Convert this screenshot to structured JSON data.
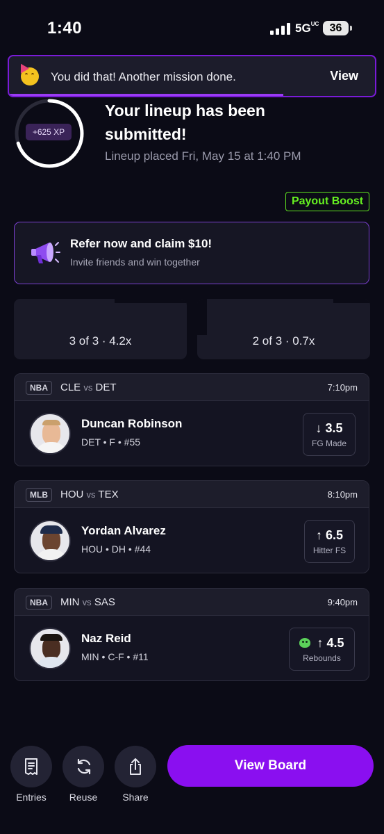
{
  "status_bar": {
    "time": "1:40",
    "network": "5G",
    "network_sup": "UC",
    "battery": "36"
  },
  "toast": {
    "message": "You did that! Another mission done.",
    "action": "View",
    "emoji": "partying-face-icon",
    "progress": 0.75
  },
  "submission": {
    "xp_label": "+625 XP",
    "xp_ring_progress": 0.7,
    "title": "Your lineup has been submitted!",
    "subtitle": "Lineup placed Fri, May 15 at 1:40 PM"
  },
  "payout_boost": "Payout Boost",
  "refer": {
    "icon": "megaphone-icon",
    "title": "Refer now and claim $10!",
    "subtitle": "Invite friends and win together"
  },
  "payout_options": [
    {
      "label": "3 of 3 · 4.2x"
    },
    {
      "label": "2 of 3 · 0.7x"
    }
  ],
  "picks": [
    {
      "league": "NBA",
      "team_a": "CLE",
      "vs": "vs",
      "team_b": "DET",
      "time": "7:10pm",
      "player": "Duncan Robinson",
      "meta": "DET • F • #55",
      "direction": "↓",
      "line": "3.5",
      "stat": "FG Made",
      "goblin": false
    },
    {
      "league": "MLB",
      "team_a": "HOU",
      "vs": "vs",
      "team_b": "TEX",
      "time": "8:10pm",
      "player": "Yordan Alvarez",
      "meta": "HOU • DH • #44",
      "direction": "↑",
      "line": "6.5",
      "stat": "Hitter FS",
      "goblin": false
    },
    {
      "league": "NBA",
      "team_a": "MIN",
      "vs": "vs",
      "team_b": "SAS",
      "time": "9:40pm",
      "player": "Naz Reid",
      "meta": "MIN • C-F • #11",
      "direction": "↑",
      "line": "4.5",
      "stat": "Rebounds",
      "goblin": true
    }
  ],
  "bottom_bar": {
    "entries": "Entries",
    "reuse": "Reuse",
    "share": "Share",
    "view_board": "View Board"
  },
  "colors": {
    "accent": "#8a0ff0",
    "boost": "#66f021",
    "background": "#0b0b16"
  }
}
